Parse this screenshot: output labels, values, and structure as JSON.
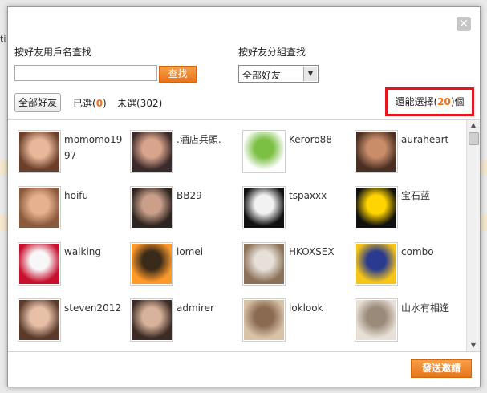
{
  "dialog": {
    "close_glyph": "✕"
  },
  "background": {
    "peek_text": "ti"
  },
  "search": {
    "label": "按好友用戶名查找",
    "value": "",
    "placeholder": "",
    "button_label": "查找"
  },
  "group": {
    "label": "按好友分組查找",
    "selected": "全部好友"
  },
  "toolbar": {
    "all_label": "全部好友",
    "selected_prefix": "已選(",
    "selected_count": "0",
    "selected_suffix": ")",
    "unselected_label": "未選(302)",
    "remaining_prefix": "還能選擇(",
    "remaining_count": "20",
    "remaining_suffix": ")個"
  },
  "friends": [
    {
      "name": "momomo1997"
    },
    {
      "name": ".酒店兵頭."
    },
    {
      "name": "Keroro88"
    },
    {
      "name": "auraheart"
    },
    {
      "name": "hoifu"
    },
    {
      "name": "BB29"
    },
    {
      "name": "tspaxxx"
    },
    {
      "name": "宝石蓝"
    },
    {
      "name": "waiking"
    },
    {
      "name": "lomei"
    },
    {
      "name": "HKOXSEX"
    },
    {
      "name": "combo"
    },
    {
      "name": "steven2012"
    },
    {
      "name": "admirer"
    },
    {
      "name": "loklook"
    },
    {
      "name": "山水有相逢"
    }
  ],
  "footer": {
    "send_label": "發送邀請"
  },
  "colors": {
    "accent": "#e8741a",
    "highlight_border": "#e8141e"
  }
}
